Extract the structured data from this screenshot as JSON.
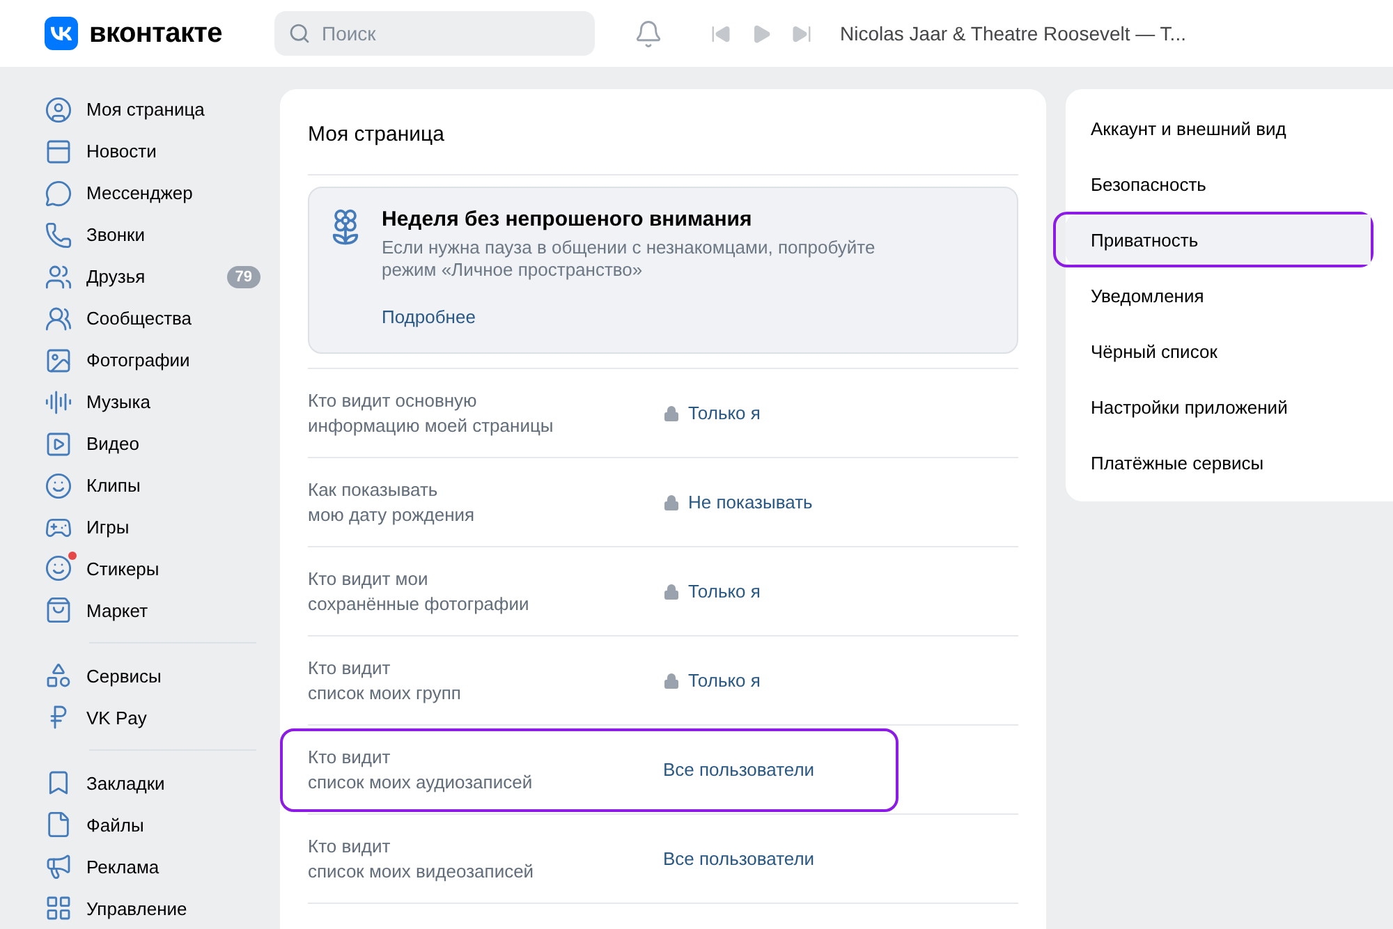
{
  "header": {
    "logo": "вконтакте",
    "search": {
      "placeholder": "Поиск"
    },
    "now_playing": "Nicolas Jaar & Theatre Roosevelt — T..."
  },
  "sidebar": {
    "groups": [
      {
        "items": [
          {
            "label": "Моя страница",
            "dot": false
          },
          {
            "label": "Новости",
            "dot": false
          },
          {
            "label": "Мессенджер",
            "dot": false
          },
          {
            "label": "Звонки",
            "dot": false
          },
          {
            "label": "Друзья",
            "count": "79",
            "dot": false
          },
          {
            "label": "Сообщества",
            "dot": false
          },
          {
            "label": "Фотографии",
            "dot": false
          },
          {
            "label": "Музыка",
            "dot": false
          },
          {
            "label": "Видео",
            "dot": false
          },
          {
            "label": "Клипы",
            "dot": false
          },
          {
            "label": "Игры",
            "dot": false
          },
          {
            "label": "Стикеры",
            "dot": true
          },
          {
            "label": "Маркет",
            "dot": false
          }
        ]
      },
      {
        "items": [
          {
            "label": "Сервисы",
            "dot": false
          },
          {
            "label": "VK Pay",
            "dot": false
          }
        ]
      },
      {
        "items": [
          {
            "label": "Закладки",
            "dot": false
          },
          {
            "label": "Файлы",
            "dot": false
          },
          {
            "label": "Реклама",
            "dot": false
          },
          {
            "label": "Управление",
            "dot": false
          }
        ]
      }
    ]
  },
  "main": {
    "title": "Моя страница",
    "banner": {
      "title": "Неделя без непрошеного внимания",
      "text": "Если нужна пауза в общении с незнакомцами, попробуйте режим «Личное пространство»",
      "link": "Подробнее"
    },
    "rows": [
      {
        "label": [
          "Кто видит основную",
          "информацию моей страницы"
        ],
        "value": "Только я",
        "locked": true,
        "highlighted": false
      },
      {
        "label": [
          "Как показывать",
          "мою дату рождения"
        ],
        "value": "Не показывать",
        "locked": true,
        "highlighted": false
      },
      {
        "label": [
          "Кто видит мои",
          "сохранённые фотографии"
        ],
        "value": "Только я",
        "locked": true,
        "highlighted": false
      },
      {
        "label": [
          "Кто видит",
          "список моих групп"
        ],
        "value": "Только я",
        "locked": true,
        "highlighted": false
      },
      {
        "label": [
          "Кто видит",
          "список моих аудиозаписей"
        ],
        "value": "Все пользователи",
        "locked": false,
        "highlighted": true
      },
      {
        "label": [
          "Кто видит",
          "список моих видеозаписей"
        ],
        "value": "Все пользователи",
        "locked": false,
        "highlighted": false
      }
    ]
  },
  "settings_menu": [
    {
      "label": "Аккаунт и внешний вид",
      "selected": false,
      "highlighted": false
    },
    {
      "label": "Безопасность",
      "selected": false,
      "highlighted": false
    },
    {
      "label": "Приватность",
      "selected": true,
      "highlighted": true
    },
    {
      "label": "Уведомления",
      "selected": false,
      "highlighted": false
    },
    {
      "label": "Чёрный список",
      "selected": false,
      "highlighted": false
    },
    {
      "label": "Настройки приложений",
      "selected": false,
      "highlighted": false
    },
    {
      "label": "Платёжные сервисы",
      "selected": false,
      "highlighted": false
    }
  ]
}
